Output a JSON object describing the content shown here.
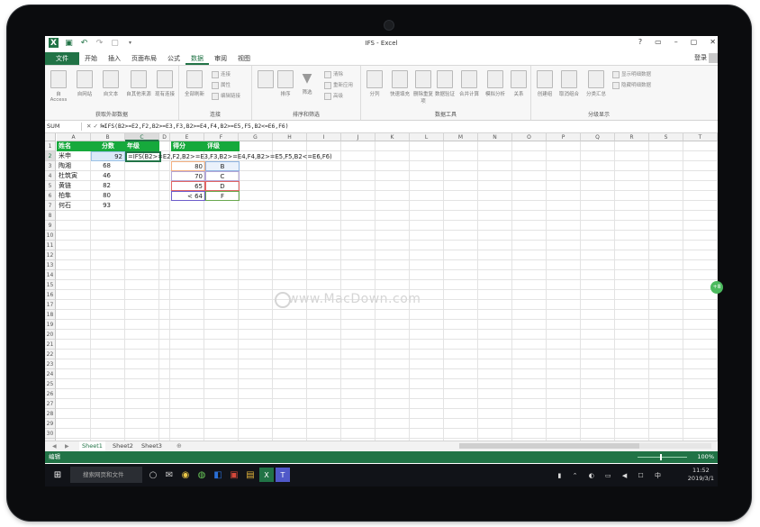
{
  "window": {
    "title": "IFS - Excel",
    "login": "登录"
  },
  "ribbon_tabs": [
    "文件",
    "开始",
    "插入",
    "页面布局",
    "公式",
    "数据",
    "审阅",
    "视图"
  ],
  "ribbon": {
    "groups": [
      {
        "label": "获取外部数据",
        "buttons": [
          "自 Access",
          "自网站",
          "自文本",
          "自其他来源",
          "现有连接"
        ]
      },
      {
        "label": "连接",
        "buttons": [
          "全部刷新"
        ],
        "small": [
          "连接",
          "属性",
          "编辑链接"
        ]
      },
      {
        "label": "排序和筛选",
        "buttons": [
          "排序",
          "筛选"
        ],
        "small": [
          "清除",
          "重新应用",
          "高级"
        ]
      },
      {
        "label": "数据工具",
        "buttons": [
          "分列",
          "快速填充",
          "删除重复项",
          "数据验证",
          "合并计算",
          "模拟分析",
          "关系"
        ]
      },
      {
        "label": "分级显示",
        "buttons": [
          "创建组",
          "取消组合",
          "分类汇总"
        ],
        "small": [
          "显示明细数据",
          "隐藏明细数据"
        ]
      }
    ]
  },
  "formula_bar": {
    "name_box": "SUM",
    "icons": "✕ ✓ fx",
    "formula": "=IFS(B2>=E2,F2,B2>=E3,F3,B2>=E4,F4,B2>=E5,F5,B2<=E6,F6)"
  },
  "columns": [
    "A",
    "B",
    "C",
    "D",
    "E",
    "F",
    "G",
    "H",
    "I",
    "J",
    "K",
    "L",
    "M",
    "N",
    "O",
    "P",
    "Q",
    "R",
    "S",
    "T"
  ],
  "rows": [
    "1",
    "2",
    "3",
    "4",
    "5",
    "6",
    "7",
    "8",
    "9",
    "10",
    "11",
    "12",
    "13",
    "14",
    "15",
    "16",
    "17",
    "18",
    "19",
    "20",
    "21",
    "22",
    "23",
    "24",
    "25",
    "26",
    "27",
    "28",
    "29",
    "30",
    "31"
  ],
  "table1": {
    "headers": [
      "姓名",
      "分数",
      "年级"
    ],
    "rows": [
      {
        "name": "米申",
        "score": "92"
      },
      {
        "name": "陶湘",
        "score": "68"
      },
      {
        "name": "杜筑寅",
        "score": "46"
      },
      {
        "name": "黄链",
        "score": "82"
      },
      {
        "name": "柏隼",
        "score": "80"
      },
      {
        "name": "何石",
        "score": "93"
      }
    ],
    "editing_formula": "=IFS(B2>=E2,F2,B2>=E3,F3,B2>=E4,F4,B2>=E5,F5,B2<=E6,F6)"
  },
  "table2": {
    "headers": [
      "得分",
      "评级"
    ],
    "rows": [
      {
        "score": "80",
        "grade": "B"
      },
      {
        "score": "70",
        "grade": "C"
      },
      {
        "score": "65",
        "grade": "D"
      },
      {
        "score": "< 64",
        "grade": "F"
      }
    ]
  },
  "watermark": "www.MacDown.com",
  "sheets": [
    "Sheet1",
    "Sheet2",
    "Sheet3"
  ],
  "status": {
    "mode": "编辑",
    "zoom": "100%"
  },
  "taskbar": {
    "search_placeholder": "搜索网页和文件",
    "time": "11:52",
    "date": "2019/3/1",
    "ime": "中"
  },
  "side_badge": "+8"
}
